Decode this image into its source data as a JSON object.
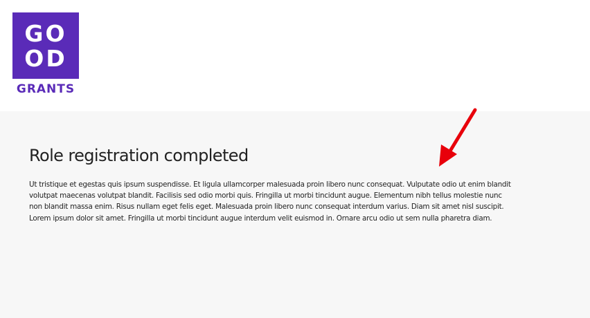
{
  "logo": {
    "line1": "GO",
    "line2": "OD",
    "wordmark": "GRANTS",
    "brand_color": "#5a2bb8"
  },
  "page": {
    "title": "Role registration completed",
    "body": "Ut tristique et egestas quis ipsum suspendisse. Et ligula ullamcorper malesuada proin libero nunc consequat. Vulputate odio ut enim blandit volutpat maecenas volutpat blandit. Facilisis sed odio morbi quis. Fringilla ut morbi tincidunt augue. Elementum nibh tellus molestie nunc non blandit massa enim. Risus nullam eget felis eget. Malesuada proin libero nunc consequat interdum varius. Diam sit amet nisl suscipit. Lorem ipsum dolor sit amet. Fringilla ut morbi tincidunt augue interdum velit euismod in. Ornare arcu odio ut sem nulla pharetra diam."
  },
  "annotation": {
    "icon": "arrow-annotation-icon",
    "color": "#e8000b"
  }
}
